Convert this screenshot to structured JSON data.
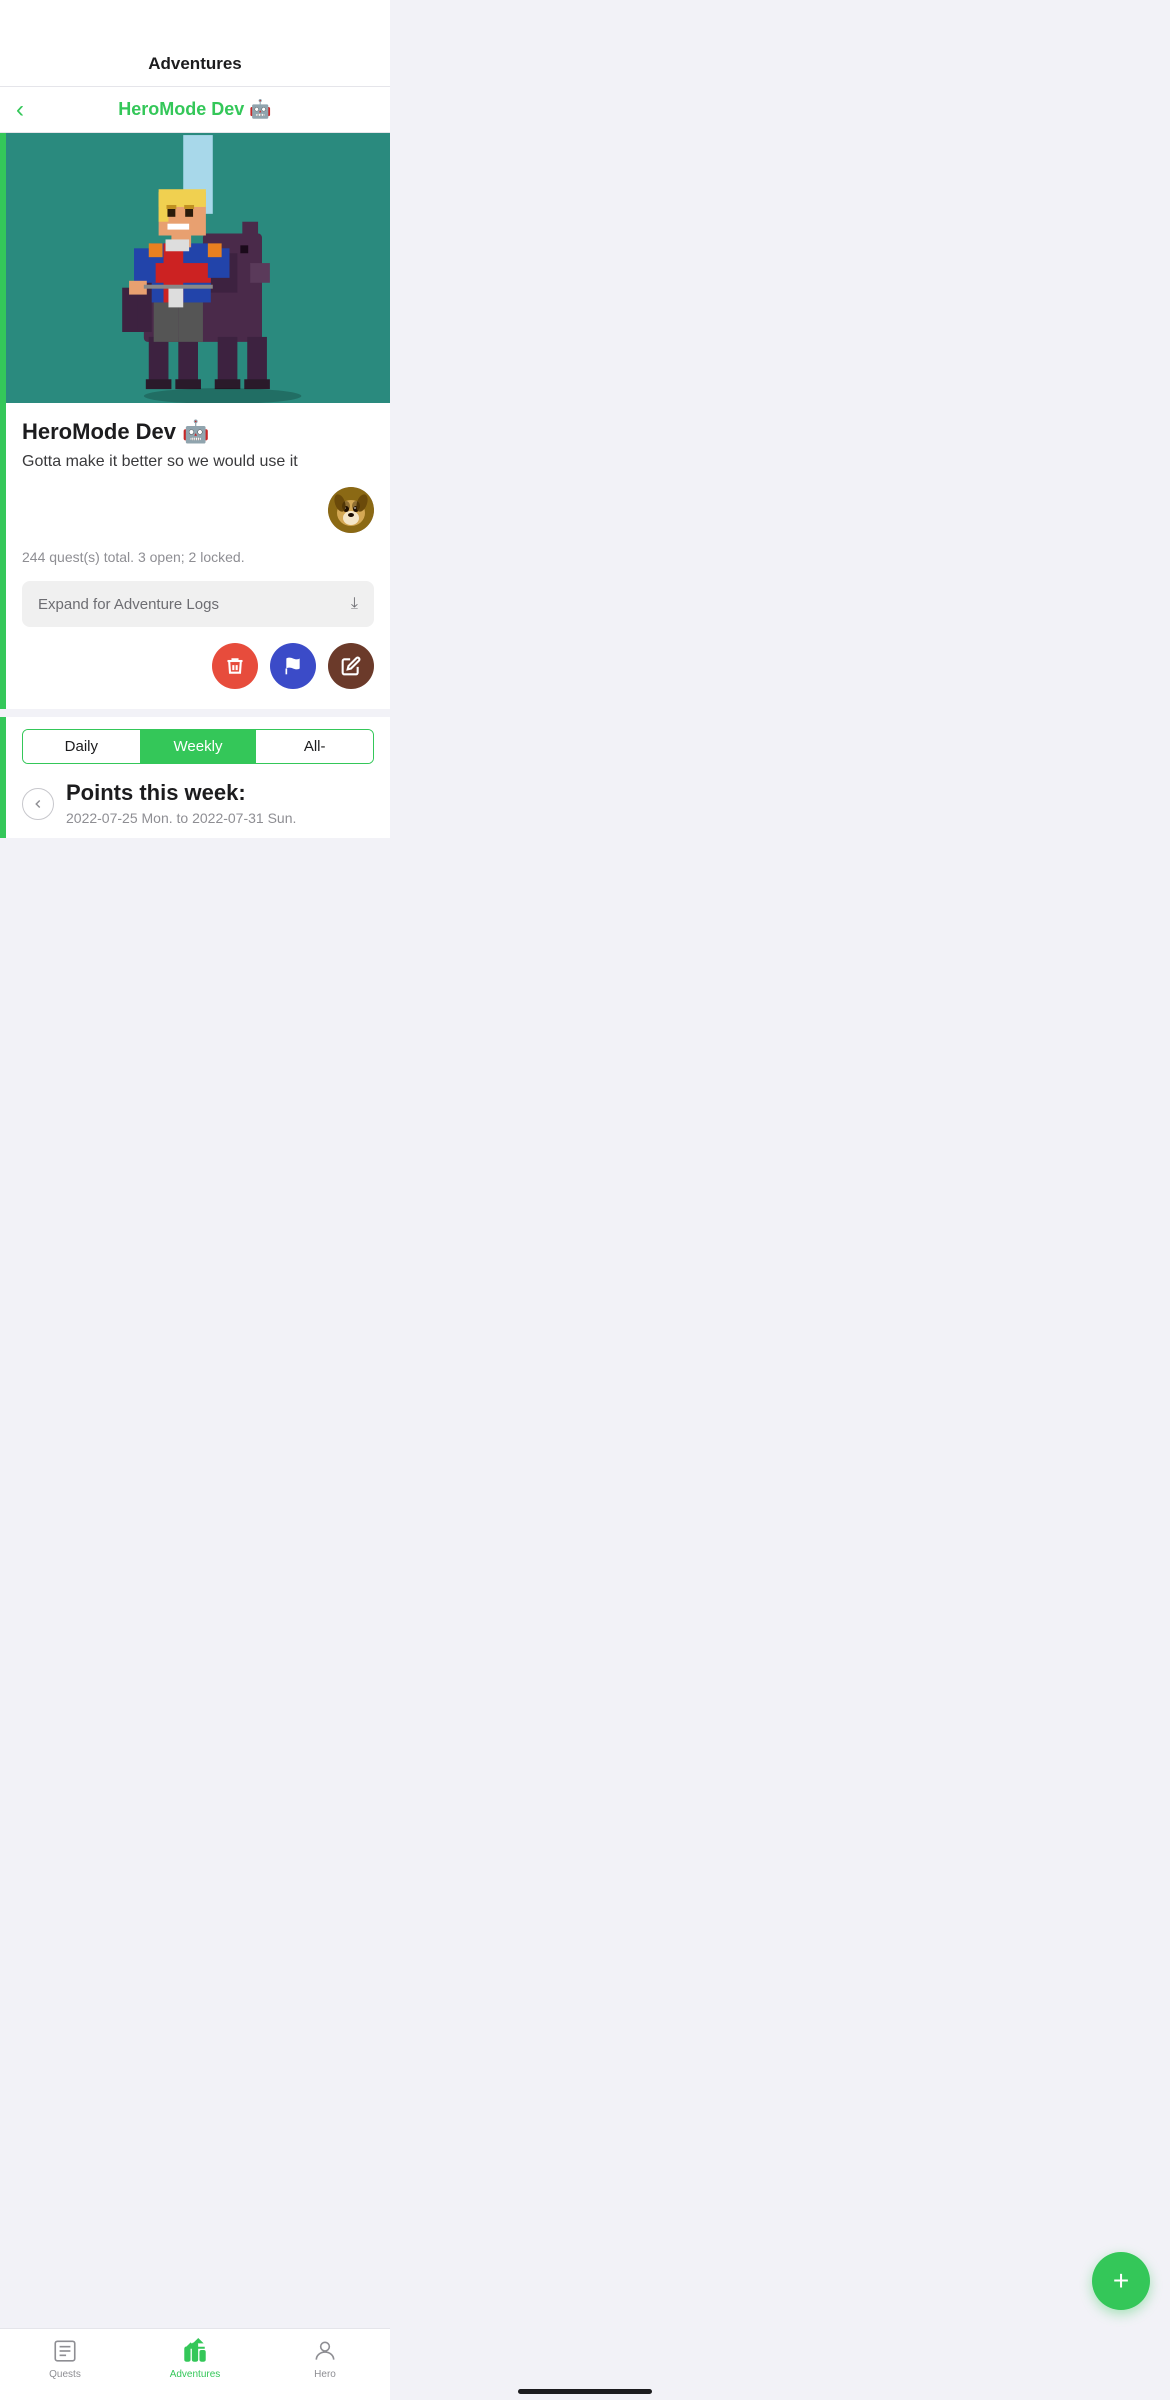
{
  "app": {
    "title": "Adventures"
  },
  "nav": {
    "back_label": "‹",
    "current_page": "HeroMode Dev 🤖"
  },
  "adventure": {
    "title": "HeroMode Dev 🤖",
    "description": "Gotta make it better so we would use it",
    "quest_stats": "244 quest(s) total. 3 open; 2 locked.",
    "expand_logs_label": "Expand for Adventure Logs",
    "chevron": "∨"
  },
  "action_buttons": {
    "delete_label": "🗑",
    "flag_label": "⚑",
    "edit_label": "✎"
  },
  "tabs": {
    "daily": "Daily",
    "weekly": "Weekly",
    "all": "All-"
  },
  "weekly_section": {
    "points_title": "Points this week:",
    "date_range": "2022-07-25 Mon. to 2022-07-31 Sun."
  },
  "fab": {
    "label": "+"
  },
  "bottom_nav": {
    "quests_label": "Quests",
    "adventures_label": "Adventures",
    "hero_label": "Hero"
  }
}
